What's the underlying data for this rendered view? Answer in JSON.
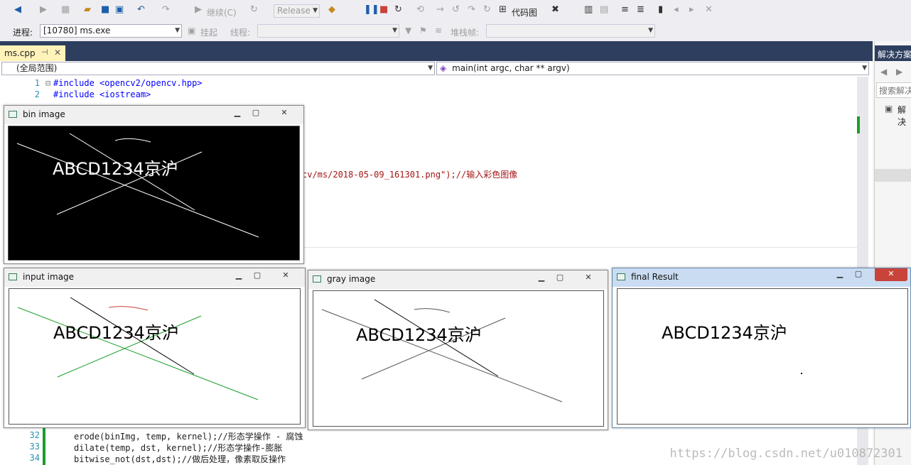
{
  "toolbar": {
    "continue_label": "继续(C)",
    "config_value": "Release",
    "codemap_label": "代码图",
    "process_label": "进程:",
    "process_value": "[10780] ms.exe",
    "suspend_label": "挂起",
    "thread_label": "线程:",
    "stackframe_label": "堆栈帧:"
  },
  "editor": {
    "tab_name": "ms.cpp",
    "scope": "(全局范围)",
    "function": "main(int argc, char ** argv)",
    "lines": [
      {
        "num": "1",
        "text": "#include <opencv2/opencv.hpp>"
      },
      {
        "num": "2",
        "text": "#include <iostream>"
      },
      {
        "num": "32",
        "text": "erode(binImg, temp, kernel);//形态学操作 - 腐蚀"
      },
      {
        "num": "33",
        "text": "dilate(temp, dst, kernel);//形态学操作-膨胀"
      },
      {
        "num": "34",
        "text": "bitwise_not(dst,dst);//做后处理，像素取反操作"
      }
    ],
    "fragment": "cv/ms/2018-05-09_161301.png\");//输入彩色图像"
  },
  "solution": {
    "title": "解决方案",
    "search": "搜索解决",
    "node": "解决"
  },
  "windows": {
    "bin_title": "bin image",
    "input_title": "input image",
    "gray_title": "gray image",
    "final_title": "final Result",
    "plate_text": "ABCD1234京沪"
  },
  "watermark": "https://blog.csdn.net/u010872301",
  "colors": {
    "vs_blue": "#2d3e5e",
    "tab_yellow": "#fff3b9",
    "green_line": "#1a9e2a",
    "close_red": "#c8433a"
  }
}
